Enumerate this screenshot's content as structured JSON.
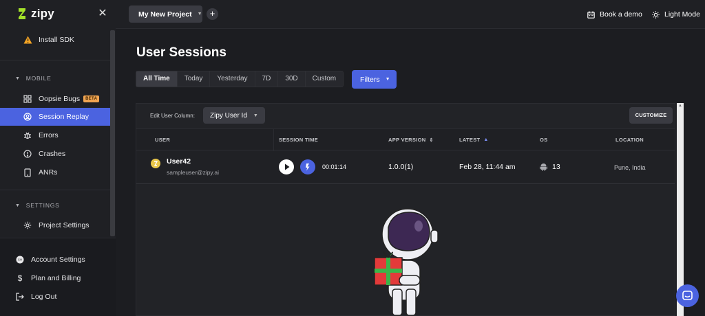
{
  "brand": {
    "name": "zipy"
  },
  "sidebar": {
    "install_sdk": "Install SDK",
    "mobile_section": "MOBILE",
    "mobile_items": [
      {
        "label": "Oopsie Bugs",
        "badge": "BETA",
        "icon": "bug-grid-icon"
      },
      {
        "label": "Session Replay",
        "icon": "session-replay-icon",
        "active": true
      },
      {
        "label": "Errors",
        "icon": "error-bug-icon"
      },
      {
        "label": "Crashes",
        "icon": "crash-icon"
      },
      {
        "label": "ANRs",
        "icon": "anr-phone-icon"
      }
    ],
    "settings_section": "SETTINGS",
    "project_settings": "Project Settings",
    "bottom_items": [
      {
        "label": "Account Settings",
        "icon": "account-avatar-icon"
      },
      {
        "label": "Plan and Billing",
        "icon": "dollar-icon"
      },
      {
        "label": "Log Out",
        "icon": "logout-icon"
      }
    ]
  },
  "topbar": {
    "project": "My New Project",
    "book_demo": "Book a demo",
    "light_mode": "Light Mode"
  },
  "main": {
    "title": "User Sessions",
    "time_filters": [
      "All Time",
      "Today",
      "Yesterday",
      "7D",
      "30D",
      "Custom"
    ],
    "active_time_filter": "All Time",
    "filters_label": "Filters",
    "edit_user_column_label": "Edit User Column:",
    "user_column_value": "Zipy User Id",
    "customize_label": "CUSTOMIZE",
    "columns": [
      "USER",
      "SESSION TIME",
      "APP VERSION",
      "LATEST",
      "OS",
      "LOCATION"
    ],
    "rows": [
      {
        "user": "User42",
        "email": "sampleuser@zipy.ai",
        "session_time": "00:01:14",
        "app_version": "1.0.0(1)",
        "latest": "Feb 28, 11:44 am",
        "os": "13",
        "location": "Pune, India"
      }
    ]
  },
  "colors": {
    "accent": "#4b63e0",
    "background": "#1c1d21",
    "beta_badge": "#f0a451",
    "warning": "#f5a524"
  }
}
